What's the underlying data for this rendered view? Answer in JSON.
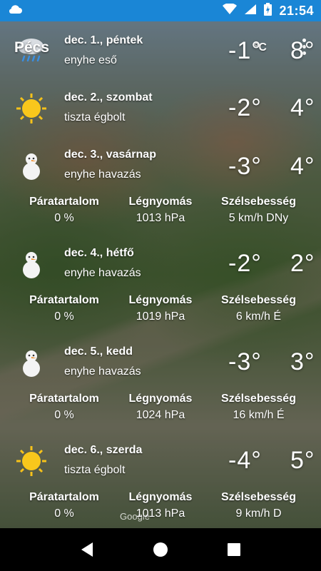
{
  "status_bar": {
    "time": "21:54",
    "icons": [
      "cloud-notification-icon",
      "wifi-icon",
      "signal-icon",
      "battery-charging-icon"
    ]
  },
  "city": "Pécs",
  "unit_toggle": "°C",
  "watermark": "Google",
  "labels": {
    "humidity": "Páratartalom",
    "pressure": "Légnyomás",
    "wind": "Szélsebesség"
  },
  "days": [
    {
      "date": "dec. 1., péntek",
      "condition": "enyhe eső",
      "icon": "rain-cloud-icon",
      "tmin": "-1°",
      "tmax": "8°"
    },
    {
      "date": "dec. 2., szombat",
      "condition": "tiszta égbolt",
      "icon": "sun-icon",
      "tmin": "-2°",
      "tmax": "4°"
    },
    {
      "date": "dec. 3., vasárnap",
      "condition": "enyhe havazás",
      "icon": "snowman-icon",
      "tmin": "-3°",
      "tmax": "4°",
      "humidity": "0 %",
      "pressure": "1013 hPa",
      "wind": "5 km/h DNy"
    },
    {
      "date": "dec. 4., hétfő",
      "condition": "enyhe havazás",
      "icon": "snowman-icon",
      "tmin": "-2°",
      "tmax": "2°",
      "humidity": "0 %",
      "pressure": "1019 hPa",
      "wind": "6 km/h É"
    },
    {
      "date": "dec. 5., kedd",
      "condition": "enyhe havazás",
      "icon": "snowman-icon",
      "tmin": "-3°",
      "tmax": "3°",
      "humidity": "0 %",
      "pressure": "1024 hPa",
      "wind": "16 km/h É"
    },
    {
      "date": "dec. 6., szerda",
      "condition": "tiszta égbolt",
      "icon": "sun-icon",
      "tmin": "-4°",
      "tmax": "5°",
      "humidity": "0 %",
      "pressure": "1013 hPa",
      "wind": "9 km/h D"
    }
  ],
  "nav": [
    "back-icon",
    "home-icon",
    "recents-icon"
  ]
}
